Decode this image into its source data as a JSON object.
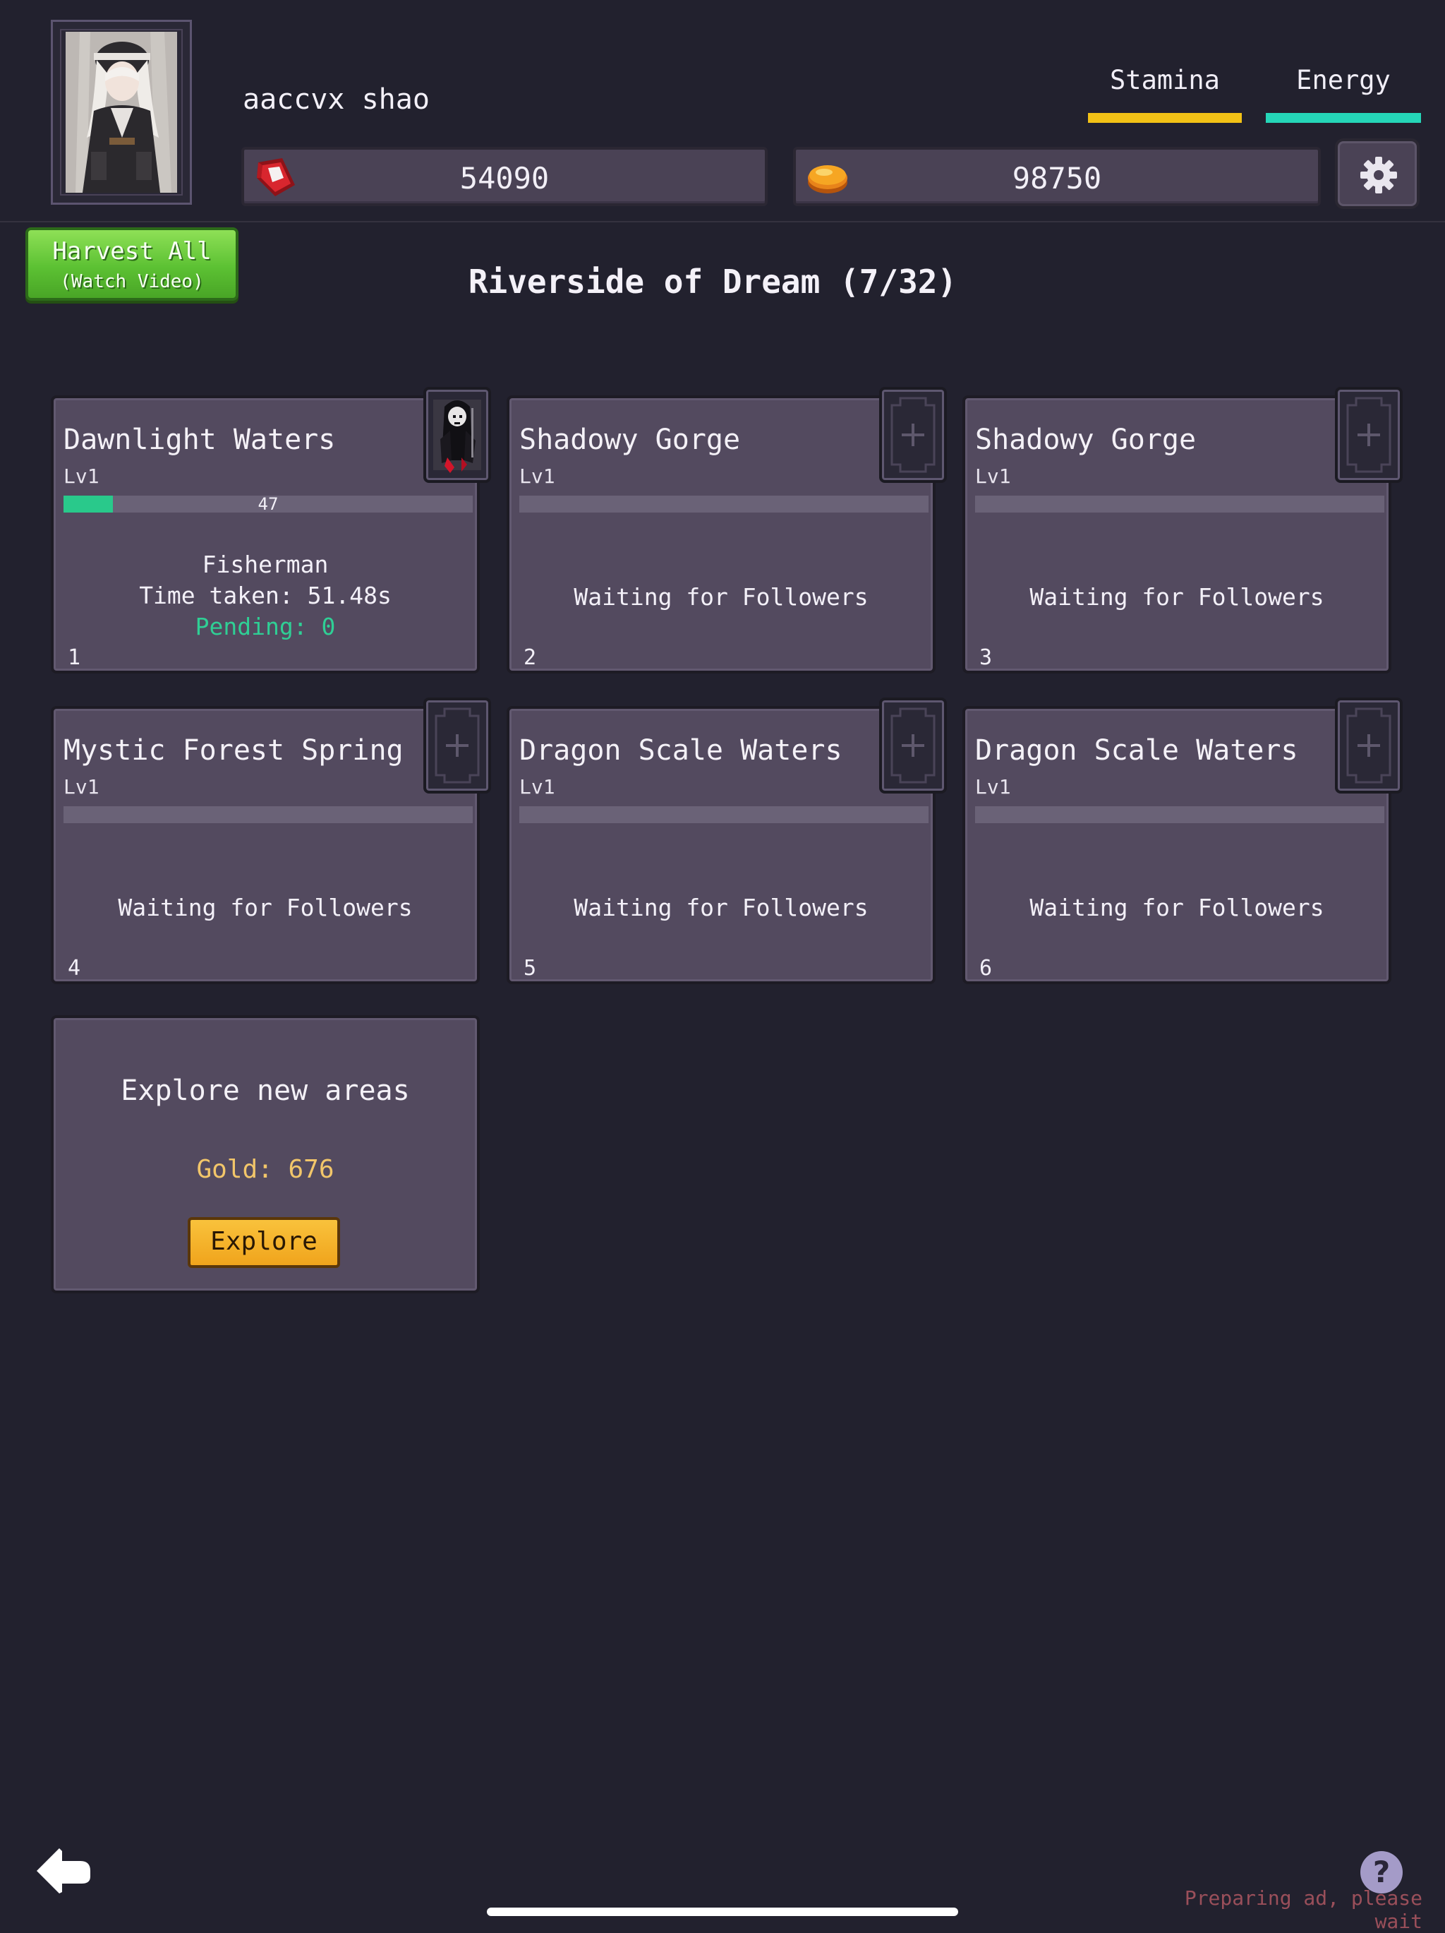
{
  "player": {
    "name": "aaccvx shao"
  },
  "stats": {
    "stamina_label": "Stamina",
    "energy_label": "Energy",
    "stamina_color": "#f2c116",
    "energy_color": "#25d6b8"
  },
  "currency": {
    "gems": "54090",
    "coins": "98750"
  },
  "harvest": {
    "line1": "Harvest All",
    "line2": "(Watch Video)"
  },
  "area": {
    "title": "Riverside of Dream (7/32)"
  },
  "cards": [
    {
      "index": "1",
      "name": "Dawnlight Waters",
      "level": "Lv1",
      "progress_value": "47",
      "progress_fraction": 0.12,
      "follower": "Fisherman",
      "time_taken": "Time taken: 51.48s",
      "pending": "Pending: 0"
    },
    {
      "index": "2",
      "name": "Shadowy Gorge",
      "level": "Lv1",
      "status": "Waiting for Followers"
    },
    {
      "index": "3",
      "name": "Shadowy Gorge",
      "level": "Lv1",
      "status": "Waiting for Followers"
    },
    {
      "index": "4",
      "name": "Mystic Forest Spring",
      "level": "Lv1",
      "status": "Waiting for Followers"
    },
    {
      "index": "5",
      "name": "Dragon Scale Waters",
      "level": "Lv1",
      "status": "Waiting for Followers"
    },
    {
      "index": "6",
      "name": "Dragon Scale Waters",
      "level": "Lv1",
      "status": "Waiting for Followers"
    }
  ],
  "explore": {
    "title": "Explore new areas",
    "gold": "Gold: 676",
    "button_label": "Explore"
  },
  "footer": {
    "help_label": "?",
    "ad_status": "Preparing ad, please wait"
  },
  "icons": {
    "gem": "red-gem-icon",
    "coin": "gold-coin-icon",
    "settings": "gear-icon",
    "back": "back-arrow-icon",
    "empty_slot": "plus-icon",
    "follower_portrait": "reaper-follower-icon"
  },
  "colors": {
    "background": "#22212e",
    "card": "#534a5f",
    "progress": "#29c98b",
    "pending": "#2fcf95",
    "gold_text": "#f2c66a",
    "ad_text": "#9a4f5a"
  }
}
